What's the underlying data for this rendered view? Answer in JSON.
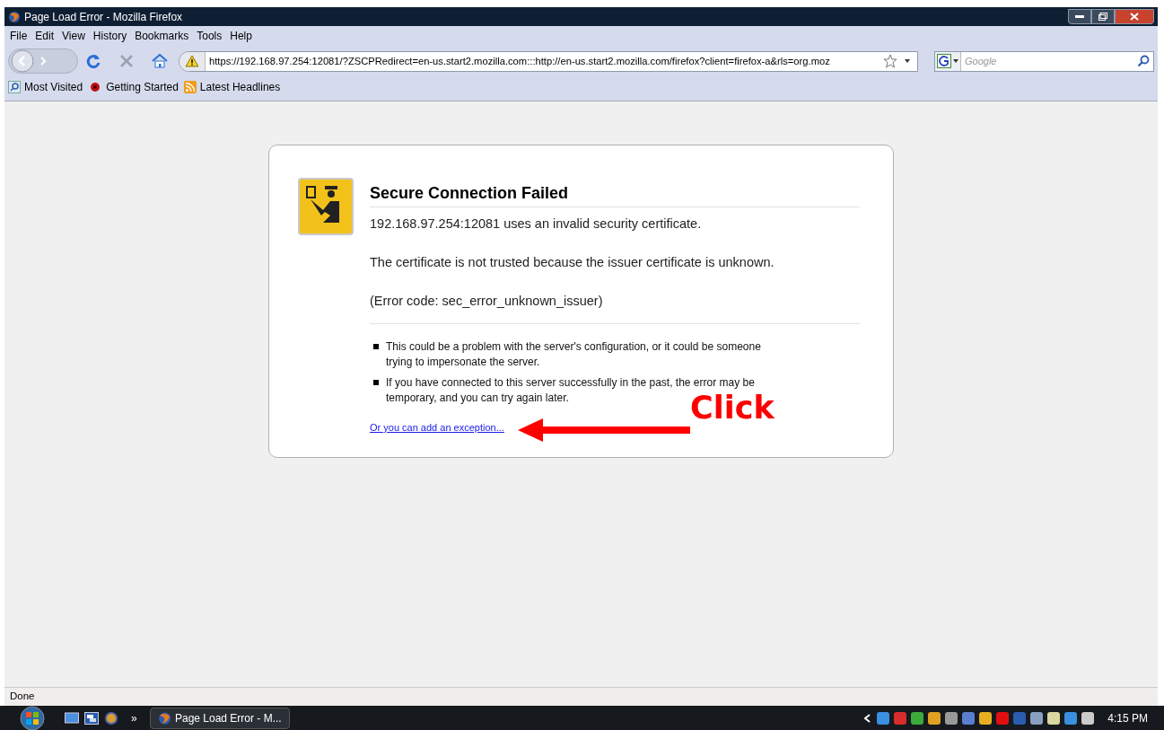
{
  "window": {
    "title": "Page Load Error - Mozilla Firefox"
  },
  "menu": [
    "File",
    "Edit",
    "View",
    "History",
    "Bookmarks",
    "Tools",
    "Help"
  ],
  "address_bar": {
    "value": "https://192.168.97.254:12081/?ZSCPRedirect=en-us.start2.mozilla.com:::http://en-us.start2.mozilla.com/firefox?client=firefox-a&rls=org.moz"
  },
  "search": {
    "placeholder": "Google"
  },
  "bookmarks": [
    {
      "label": "Most Visited",
      "kind": "search"
    },
    {
      "label": "Getting Started",
      "kind": "firefox"
    },
    {
      "label": "Latest Headlines",
      "kind": "feed"
    }
  ],
  "error": {
    "title": "Secure Connection Failed",
    "messages": [
      "192.168.97.254:12081 uses an invalid security certificate.",
      "The certificate is not trusted because the issuer certificate is unknown.",
      "(Error code: sec_error_unknown_issuer)"
    ],
    "bullets": [
      "This could be a problem with the server's configuration, or it could be someone trying to impersonate the server.",
      "If you have connected to this server successfully in the past, the error may be temporary, and you can try again later."
    ],
    "link": "Or you can add an exception..."
  },
  "annotation": {
    "label": "Click"
  },
  "status_bar": {
    "text": "Done"
  },
  "taskbar": {
    "overflow": "»",
    "task": "Page Load Error - M...",
    "clock": "4:15 PM"
  }
}
